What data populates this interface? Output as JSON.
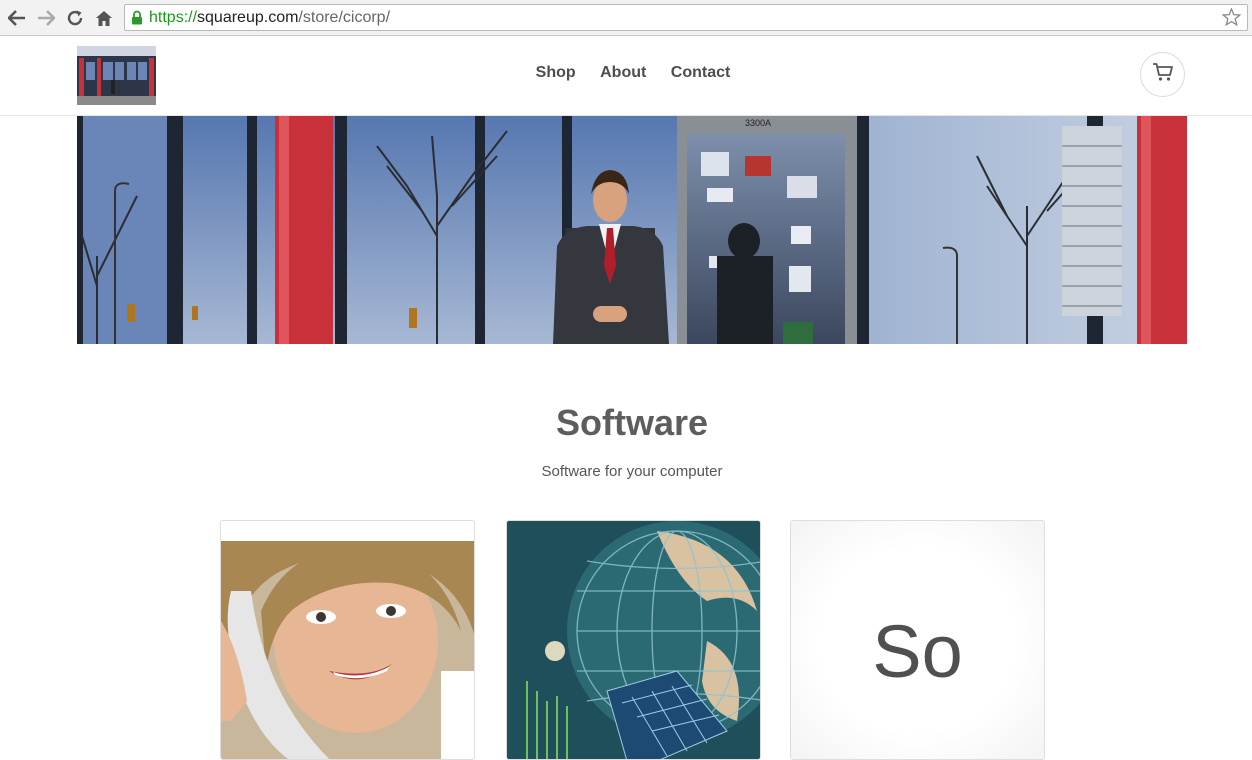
{
  "browser": {
    "url_scheme": "https://",
    "url_domain": "squareup.com",
    "url_path": "/store/cicorp/",
    "icons": [
      "back-arrow-icon",
      "forward-arrow-icon",
      "reload-icon",
      "home-icon",
      "lock-icon",
      "bookmark-star-icon"
    ]
  },
  "header": {
    "nav": [
      {
        "label": "Shop"
      },
      {
        "label": "About"
      },
      {
        "label": "Contact"
      }
    ],
    "cart_icon": "cart-icon"
  },
  "section": {
    "title": "Software",
    "subtitle": "Software for your computer"
  },
  "products": [
    {
      "image": "woman-on-phone-photo"
    },
    {
      "image": "globe-network-photo"
    },
    {
      "placeholder_text": "So"
    }
  ],
  "colors": {
    "nav_text": "#4d4d4d",
    "title_text": "#5d5d5d",
    "url_secure_green": "#1a9a1a",
    "storefront_red": "#c8303a"
  }
}
